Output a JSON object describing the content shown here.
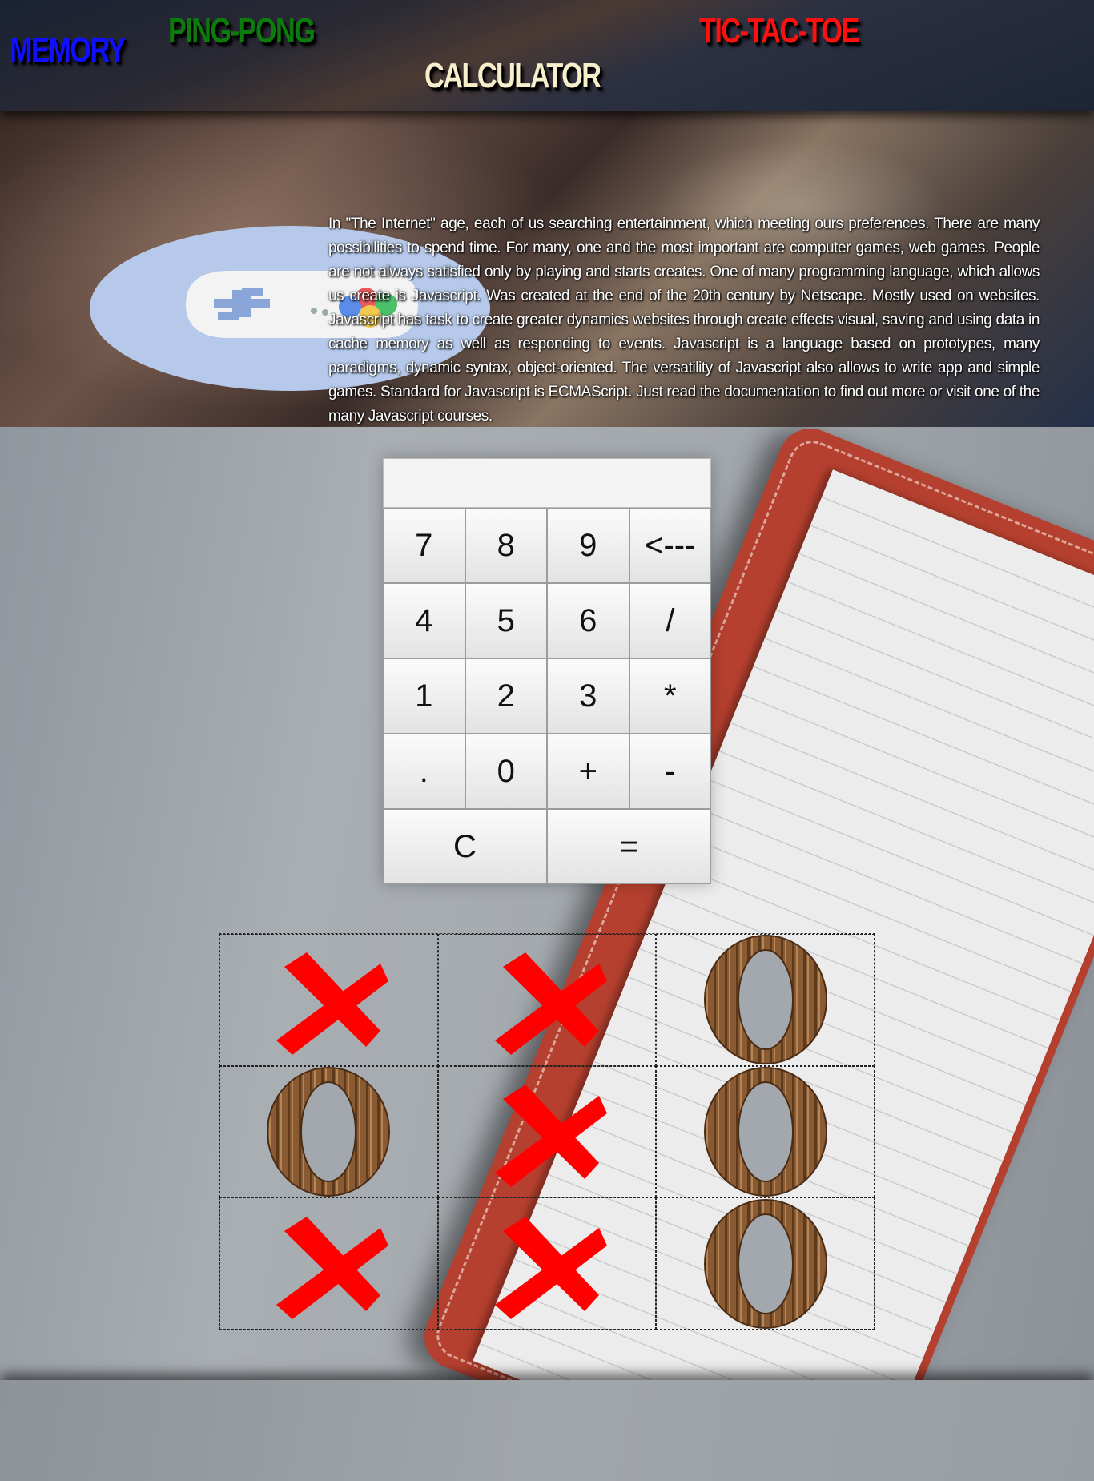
{
  "nav": {
    "memory": "MEMORY",
    "ping_pong": "PING-PONG",
    "calculator": "CALCULATOR",
    "tic_tac_toe": "TIC-TAC-TOE"
  },
  "intro": {
    "text": "In \"The Internet\" age, each of us searching entertainment, which meeting ours preferences. There are many possibilities to spend time. For many, one and the most important are computer games, web games. People are not always satisfied only by playing and starts creates. One of many programming language, which allows us create is Javascript. Was created at the end of the 20th century by Netscape. Mostly used on websites. Javascript has task to create greater dynamics websites through create effects visual, saving and using data in cache memory as well as responding to events. Javascript is a language based on prototypes, many paradigms, dynamic syntax, object-oriented. The versatility of Javascript also allows to write app and simple games. Standard for Javascript is ECMAScript. Just read the documentation to find out more or visit one of the many Javascript courses."
  },
  "calculator": {
    "display": "",
    "buttons": [
      "7",
      "8",
      "9",
      "<---",
      "4",
      "5",
      "6",
      "/",
      "1",
      "2",
      "3",
      "*",
      ".",
      "0",
      "+",
      "-",
      "C",
      "="
    ]
  },
  "tictactoe": {
    "board": [
      "X",
      "X",
      "O",
      "O",
      "X",
      "O",
      "X",
      "X",
      "O"
    ]
  },
  "colors": {
    "memory": "#1010ff",
    "ping_pong": "#0d7a0d",
    "calculator": "#f6efc9",
    "tic_tac_toe": "#ff1010",
    "x_mark": "#ff0000",
    "o_mark": "#8a5a32"
  }
}
